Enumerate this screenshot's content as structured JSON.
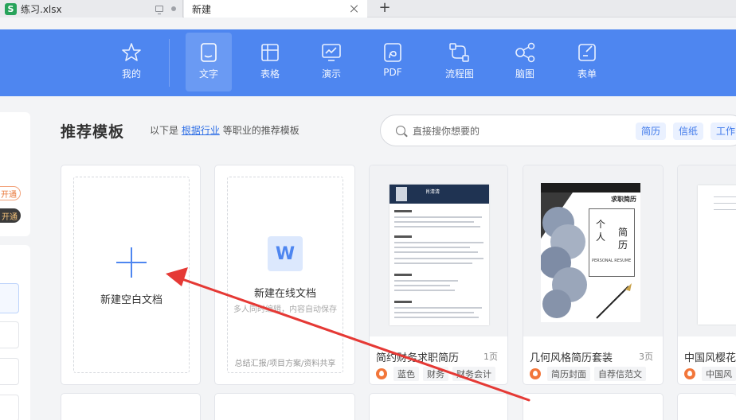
{
  "tabs": [
    {
      "label": "练习.xlsx",
      "icon": "spreadsheet-icon",
      "icon_letter": "S"
    },
    {
      "label": "新建"
    }
  ],
  "new_tab_label": "+",
  "nav": [
    {
      "label": "我的",
      "icon": "star-icon"
    },
    {
      "label": "文字",
      "icon": "document-icon",
      "active": true
    },
    {
      "label": "表格",
      "icon": "table-icon"
    },
    {
      "label": "演示",
      "icon": "presentation-icon"
    },
    {
      "label": "PDF",
      "icon": "pdf-icon"
    },
    {
      "label": "流程图",
      "icon": "flowchart-icon"
    },
    {
      "label": "脑图",
      "icon": "mindmap-icon"
    },
    {
      "label": "表单",
      "icon": "form-icon"
    }
  ],
  "sidebar": {
    "pill1": "开通",
    "pill2": "开通"
  },
  "section": {
    "title": "推荐模板",
    "sub_prefix": "以下是",
    "sub_link": "根据行业",
    "sub_suffix": "等职业的推荐模板"
  },
  "search": {
    "placeholder": "直接搜你想要的",
    "tags": [
      "简历",
      "信纸",
      "工作"
    ]
  },
  "cards": {
    "blank": {
      "label": "新建空白文档"
    },
    "online": {
      "icon_letter": "W",
      "label": "新建在线文档",
      "sub": "多人同时编辑，内容自动保存",
      "foot": "总结汇报/项目方案/资料共享"
    },
    "templates": [
      {
        "title": "简约财务求职简历",
        "pages": "1页",
        "tags": [
          "蓝色",
          "财务",
          "财务会计"
        ]
      },
      {
        "title": "几何风格简历套装",
        "pages": "3页",
        "tags": [
          "简历封面",
          "自荐信范文"
        ]
      },
      {
        "title": "中国风樱花平",
        "pages": "",
        "tags": [
          "中国风"
        ]
      }
    ]
  },
  "thumbs": {
    "resume_name": "肖清清",
    "geo_title": "求职简历",
    "geo_chars": [
      "个",
      "人",
      "简",
      "历"
    ],
    "geo_en": "PERSONAL RESUME"
  },
  "colors": {
    "toolbar": "#4e86f0",
    "accent": "#2f6fe6",
    "arrow": "#e53935"
  }
}
